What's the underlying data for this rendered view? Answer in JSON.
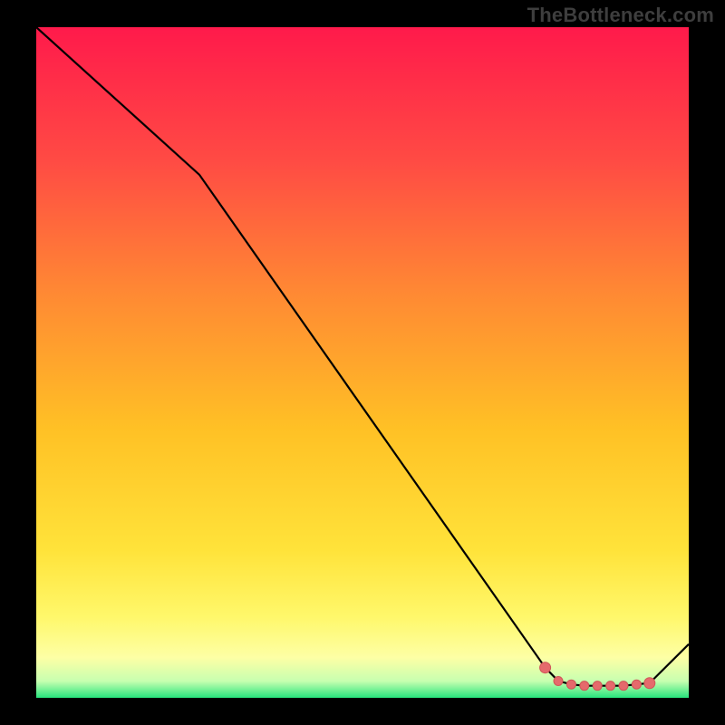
{
  "attribution": "TheBottleneck.com",
  "colors": {
    "frame": "#000000",
    "attribution_text": "#3e3e3e",
    "line": "#000000",
    "marker_fill": "#e56a6c",
    "marker_stroke": "#d05557",
    "gradient_stops": [
      {
        "offset": 0.0,
        "color": "#ff1a4b"
      },
      {
        "offset": 0.2,
        "color": "#ff4b44"
      },
      {
        "offset": 0.4,
        "color": "#ff8a33"
      },
      {
        "offset": 0.6,
        "color": "#ffc125"
      },
      {
        "offset": 0.78,
        "color": "#ffe33a"
      },
      {
        "offset": 0.88,
        "color": "#fff86b"
      },
      {
        "offset": 0.94,
        "color": "#fdffa5"
      },
      {
        "offset": 0.975,
        "color": "#c8ffb0"
      },
      {
        "offset": 1.0,
        "color": "#27e57d"
      }
    ]
  },
  "chart_data": {
    "type": "line",
    "title": "",
    "xlabel": "",
    "ylabel": "",
    "xlim": [
      0,
      100
    ],
    "ylim": [
      0,
      100
    ],
    "x": [
      0,
      25,
      78,
      80,
      82,
      84,
      86,
      88,
      90,
      92,
      94,
      100
    ],
    "y": [
      100,
      78,
      4.5,
      2.5,
      2.0,
      1.8,
      1.8,
      1.8,
      1.8,
      2.0,
      2.2,
      8
    ],
    "markers": {
      "x": [
        78,
        80,
        82,
        84,
        86,
        88,
        90,
        92,
        94
      ],
      "y": [
        4.5,
        2.5,
        2.0,
        1.8,
        1.8,
        1.8,
        1.8,
        2.0,
        2.2
      ]
    }
  }
}
